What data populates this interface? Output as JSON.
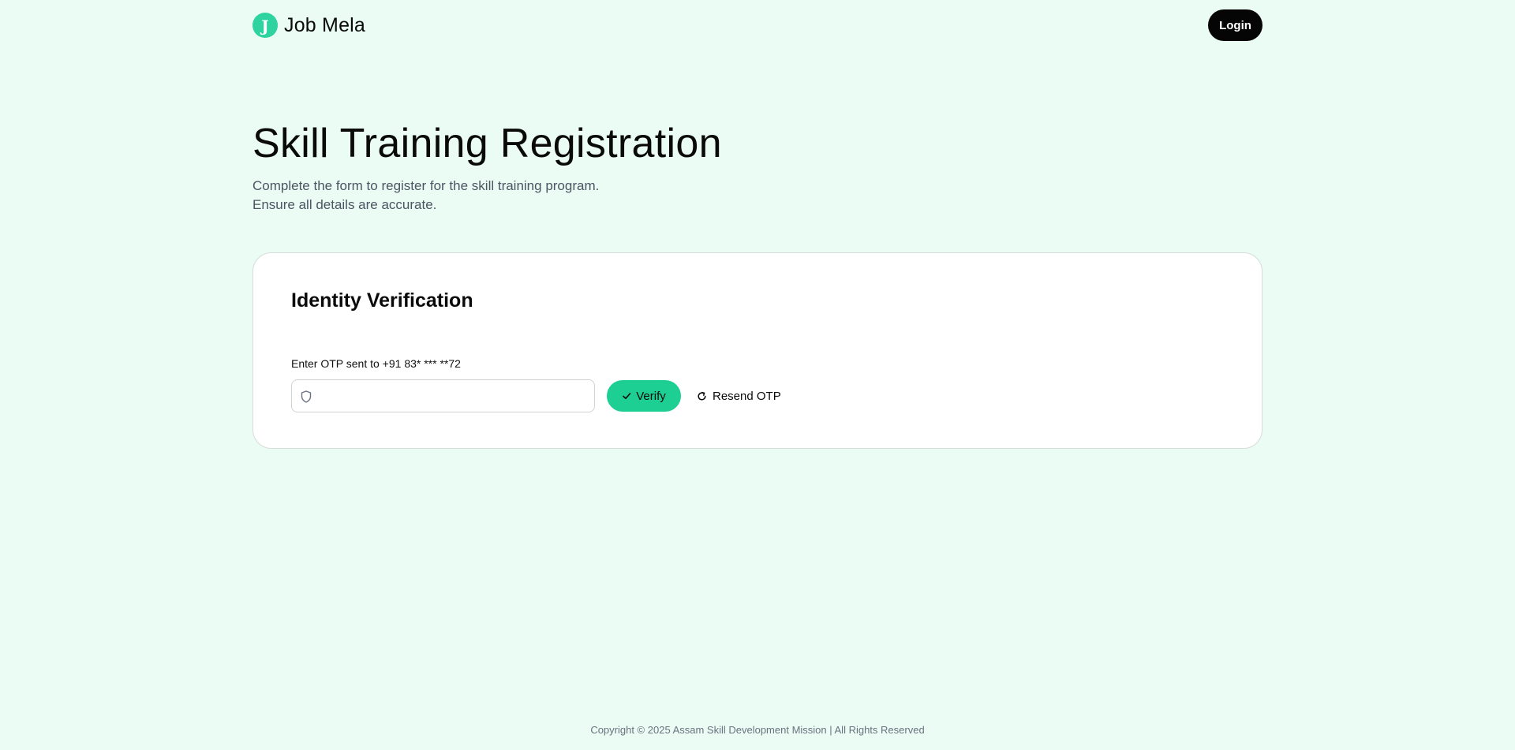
{
  "brand": {
    "logo_letter": "J",
    "name": "Job Mela"
  },
  "header": {
    "login_label": "Login"
  },
  "hero": {
    "title": "Skill Training Registration",
    "subtitle_line1": "Complete the form to register for the skill training program.",
    "subtitle_line2": "Ensure all details are accurate."
  },
  "verification": {
    "title": "Identity Verification",
    "otp_label": "Enter OTP sent to +91 83* *** **72",
    "otp_value": "",
    "otp_placeholder": "",
    "input_icon": "shield-icon",
    "verify_label": "Verify",
    "verify_icon": "check-icon",
    "resend_label": "Resend OTP",
    "resend_icon": "refresh-icon"
  },
  "footer": {
    "copyright": "Copyright © 2025 Assam Skill Development Mission | All Rights Reserved"
  },
  "colors": {
    "background": "#eafcf3",
    "accent": "#1ecf93",
    "logo": "#2ed3a0",
    "login_button": "#050505"
  }
}
